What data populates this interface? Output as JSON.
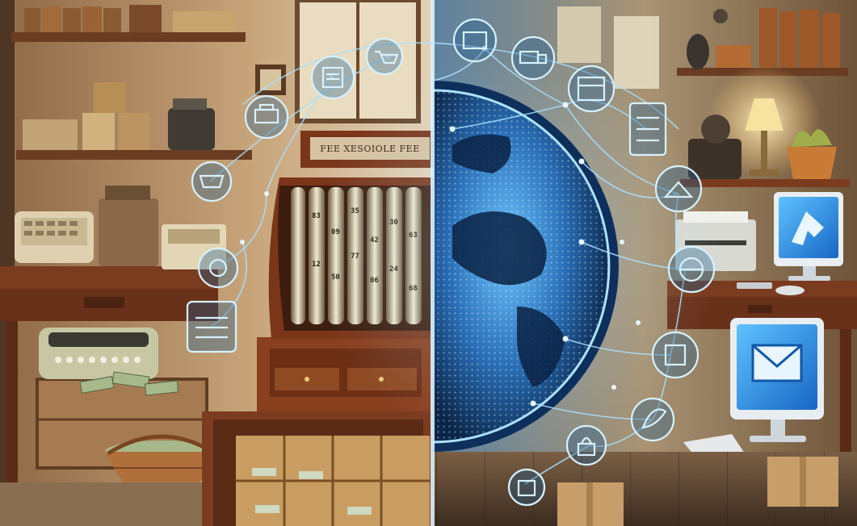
{
  "scene": {
    "register_sign_text": "FEE XESOIOLE FEE",
    "left_half_theme": "vintage office with cash register",
    "right_half_theme": "digital globe network with computers"
  },
  "icons": [
    "receipt-icon",
    "cart-icon",
    "truck-icon",
    "printer-icon",
    "store-icon",
    "cash-register-icon",
    "calendar-icon",
    "shop-icon",
    "bank-icon",
    "globe-icon",
    "document-icon",
    "rocket-icon",
    "network-icon",
    "lock-icon",
    "chart-icon"
  ],
  "colors": {
    "wood_dark": "#5a2e1a",
    "wood_light": "#a4582f",
    "wall_warm": "#c9a67c",
    "glow_blue": "#7fd2ff",
    "screen_blue": "#2b90e8",
    "globe_deep": "#0c2a52"
  }
}
